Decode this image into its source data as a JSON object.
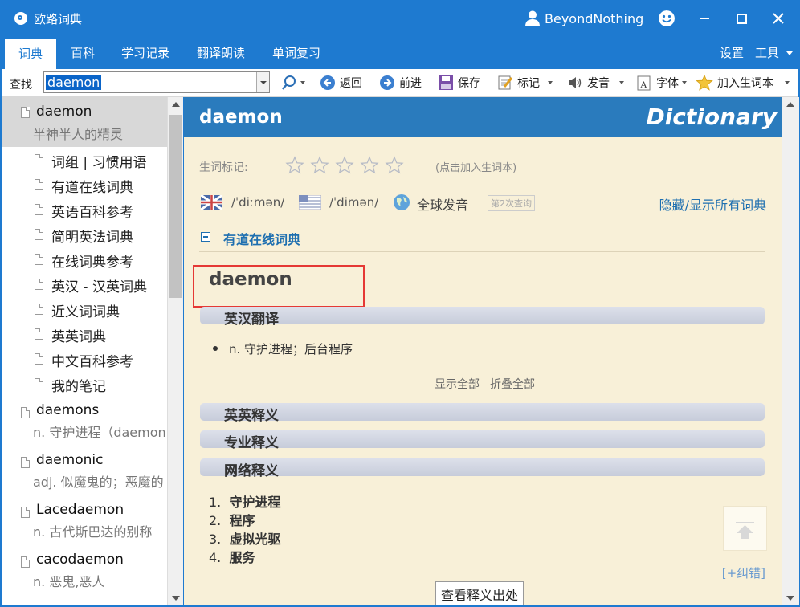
{
  "app": {
    "title": "欧路词典",
    "user": "BeyondNothing"
  },
  "tabs": [
    "词典",
    "百科",
    "学习记录",
    "翻译朗读",
    "单词复习"
  ],
  "top_right": {
    "settings": "设置",
    "tools": "工具"
  },
  "toolbar": {
    "search_label": "查找",
    "search_value": "daemon",
    "back": "返回",
    "forward": "前进",
    "save": "保存",
    "mark": "标记",
    "pronounce": "发音",
    "font": "字体",
    "add_vocab": "加入生词本"
  },
  "sidebar": {
    "main": {
      "word": "daemon",
      "def": "半神半人的精灵"
    },
    "subs": [
      "词组 | 习惯用语",
      "有道在线词典",
      "英语百科参考",
      "简明英法词典",
      "在线词典参考",
      "英汉 - 汉英词典",
      "近义词词典",
      "英英词典",
      "中文百科参考",
      "我的笔记"
    ],
    "others": [
      {
        "word": "daemons",
        "def": "n. 守护进程（daemon的复数）"
      },
      {
        "word": "daemonic",
        "def": "adj. 似魔鬼的；恶魔的"
      },
      {
        "word": "Lacedaemon",
        "def": "n. 古代斯巴达的别称"
      },
      {
        "word": "cacodaemon",
        "def": "n. 恶鬼,恶人"
      }
    ]
  },
  "content": {
    "header_word": "daemon",
    "header_brand": "Dictionary",
    "vocab_mark_label": "生词标记:",
    "vocab_hint": "(点击加入生词本)",
    "uk_phonetic": "/ˈdiːmən/",
    "us_phonetic": "/ˈdimən/",
    "global_pron": "全球发音",
    "query_count": "第2次查询",
    "toggle_all": "隐藏/显示所有词典",
    "section_title": "有道在线词典",
    "headword": "daemon",
    "en_cn_title": "英汉翻译",
    "definition": "n. 守护进程；后台程序",
    "show_all": "显示全部",
    "collapse_all": "折叠全部",
    "en_en_title": "英英释义",
    "pro_title": "专业释义",
    "web_title": "网络释义",
    "web_items": [
      "守护进程",
      "程序",
      "虚拟光驱",
      "服务"
    ],
    "correction": "[+纠错]",
    "source_button": "查看释义出处"
  },
  "colors": {
    "accent": "#1e7ad0",
    "content_bg": "#f8f0d8",
    "header_bg": "#2a7bbd",
    "highlight": "#e53935"
  }
}
